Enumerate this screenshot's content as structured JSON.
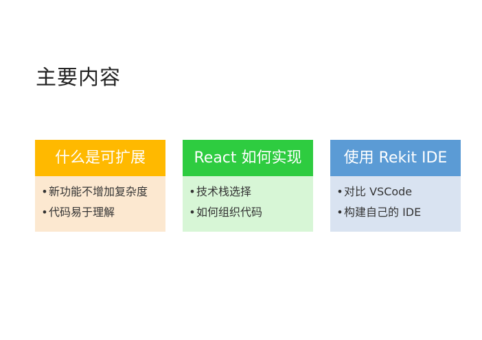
{
  "slide": {
    "title": "主要内容"
  },
  "cards": [
    {
      "header": "什么是可扩展",
      "header_color": "#ffb900",
      "body_color": "#fce8d0",
      "items": [
        "新功能不增加复杂度",
        "代码易于理解"
      ]
    },
    {
      "header": "React 如何实现",
      "header_color": "#2ecc40",
      "body_color": "#d7f6d6",
      "items": [
        "技术栈选择",
        "如何组织代码"
      ]
    },
    {
      "header": "使用 Rekit IDE",
      "header_color": "#5b9bd5",
      "body_color": "#d9e3f1",
      "items": [
        "对比 VSCode",
        "构建自己的 IDE"
      ]
    }
  ],
  "bullet_glyph": "•"
}
